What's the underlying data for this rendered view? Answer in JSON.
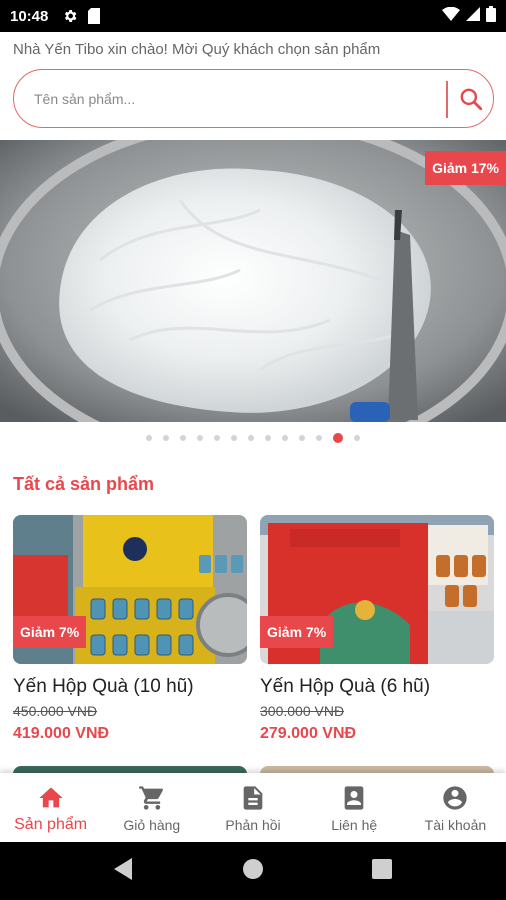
{
  "status_bar": {
    "time": "10:48"
  },
  "header": {
    "greeting": "Nhà Yến Tibo xin chào! Mời Quý khách chọn sản phẩm",
    "search": {
      "placeholder": "Tên sản phẩm..."
    }
  },
  "banner": {
    "discount": "Giảm 17%",
    "slide_count": 13,
    "active_slide": 12
  },
  "section": {
    "title": "Tất cả sản phẩm"
  },
  "products": [
    {
      "name": "Yến Hộp Quà (10 hũ)",
      "old_price": "450.000 VNĐ",
      "price": "419.000 VNĐ",
      "discount": "Giảm 7%"
    },
    {
      "name": "Yến Hộp Quà (6 hũ)",
      "old_price": "300.000 VNĐ",
      "price": "279.000 VNĐ",
      "discount": "Giảm 7%"
    }
  ],
  "bottom_nav": {
    "items": [
      {
        "label": "Sản phẩm",
        "icon": "home-icon",
        "active": true
      },
      {
        "label": "Giỏ hàng",
        "icon": "cart-icon"
      },
      {
        "label": "Phản hồi",
        "icon": "feedback-icon"
      },
      {
        "label": "Liên hệ",
        "icon": "contact-icon"
      },
      {
        "label": "Tài khoản",
        "icon": "account-icon"
      }
    ]
  },
  "colors": {
    "accent": "#e8474c",
    "search_border": "#e3686b"
  }
}
